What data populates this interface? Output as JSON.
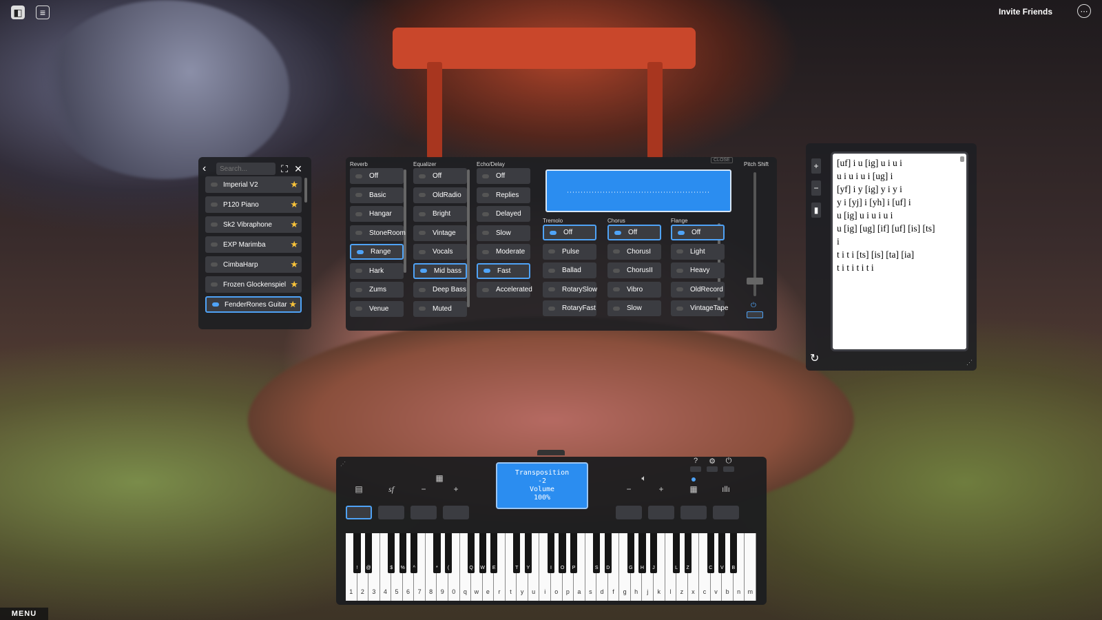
{
  "topbar": {
    "invite_label": "Invite Friends",
    "menu_label": "MENU"
  },
  "instruments": {
    "search_placeholder": "Search...",
    "items": [
      {
        "label": "Imperial V2",
        "selected": false
      },
      {
        "label": "P120 Piano",
        "selected": false
      },
      {
        "label": "Sk2 Vibraphone",
        "selected": false
      },
      {
        "label": "EXP Marimba",
        "selected": false
      },
      {
        "label": "CimbaHarp",
        "selected": false
      },
      {
        "label": "Frozen Glockenspiel",
        "selected": false
      },
      {
        "label": "FenderRones Guitar",
        "selected": true
      }
    ]
  },
  "effects": {
    "close_label": "CLOSE",
    "pitch_shift_label": "Pitch Shift",
    "reverb": {
      "title": "Reverb",
      "options": [
        "Off",
        "Basic",
        "Hangar",
        "StoneRoom",
        "Range",
        "Hark",
        "Zums",
        "Venue"
      ],
      "selected": 4
    },
    "equalizer": {
      "title": "Equalizer",
      "options": [
        "Off",
        "OldRadio",
        "Bright",
        "Vintage",
        "Vocals",
        "Mid bass",
        "Deep Bass",
        "Muted"
      ],
      "selected": 5
    },
    "echo": {
      "title": "Echo/Delay",
      "options": [
        "Off",
        "Replies",
        "Delayed",
        "Slow",
        "Moderate",
        "Fast",
        "Accelerated"
      ],
      "selected": 5
    },
    "tremolo": {
      "title": "Tremolo",
      "options": [
        "Off",
        "Pulse",
        "Ballad",
        "RotarySlow",
        "RotaryFast"
      ],
      "selected": 0
    },
    "chorus": {
      "title": "Chorus",
      "options": [
        "Off",
        "ChorusI",
        "ChorusII",
        "Vibro",
        "Slow"
      ],
      "selected": 0
    },
    "flange": {
      "title": "Flange",
      "options": [
        "Off",
        "Light",
        "Heavy",
        "OldRecord",
        "VintageTape"
      ],
      "selected": 0
    }
  },
  "sheet": {
    "lines": [
      "[uf] i u [ig] u i u i",
      "u i u i u i [ug] i",
      "[yf] i y [ig] y i y i",
      "y i [yj] i [yh] i [uf] i",
      "u [ig] u i u i u i",
      "u [ig] [ug] [if] [uf] [is] [ts]",
      "i",
      "t i t i [ts] [is] [ta] [ia]",
      "t i t i t i t i"
    ]
  },
  "piano": {
    "display": {
      "line1": "Transposition",
      "line2": "-2",
      "line3": "Volume",
      "line4": "100%"
    },
    "white_keys": [
      "1",
      "2",
      "3",
      "4",
      "5",
      "6",
      "7",
      "8",
      "9",
      "0",
      "q",
      "w",
      "e",
      "r",
      "t",
      "y",
      "u",
      "i",
      "o",
      "p",
      "a",
      "s",
      "d",
      "f",
      "g",
      "h",
      "j",
      "k",
      "l",
      "z",
      "x",
      "c",
      "v",
      "b",
      "n",
      "m"
    ],
    "black_keys": [
      {
        "after": 0,
        "label": "!"
      },
      {
        "after": 1,
        "label": "@"
      },
      {
        "after": 3,
        "label": "$"
      },
      {
        "after": 4,
        "label": "%"
      },
      {
        "after": 5,
        "label": "^"
      },
      {
        "after": 7,
        "label": "*"
      },
      {
        "after": 8,
        "label": "("
      },
      {
        "after": 10,
        "label": "Q"
      },
      {
        "after": 11,
        "label": "W"
      },
      {
        "after": 12,
        "label": "E"
      },
      {
        "after": 14,
        "label": "T"
      },
      {
        "after": 15,
        "label": "Y"
      },
      {
        "after": 17,
        "label": "I"
      },
      {
        "after": 18,
        "label": "O"
      },
      {
        "after": 19,
        "label": "P"
      },
      {
        "after": 21,
        "label": "S"
      },
      {
        "after": 22,
        "label": "D"
      },
      {
        "after": 24,
        "label": "G"
      },
      {
        "after": 25,
        "label": "H"
      },
      {
        "after": 26,
        "label": "J"
      },
      {
        "after": 28,
        "label": "L"
      },
      {
        "after": 29,
        "label": "Z"
      },
      {
        "after": 31,
        "label": "C"
      },
      {
        "after": 32,
        "label": "V"
      },
      {
        "after": 33,
        "label": "B"
      }
    ],
    "controls_left": [
      "sheet-icon",
      "sustain-icon",
      "minus-icon",
      "plus-icon"
    ],
    "controls_right": [
      "minus-icon",
      "plus-icon",
      "calculator-icon",
      "waveform-icon"
    ],
    "accent": "#4fa3f7"
  }
}
